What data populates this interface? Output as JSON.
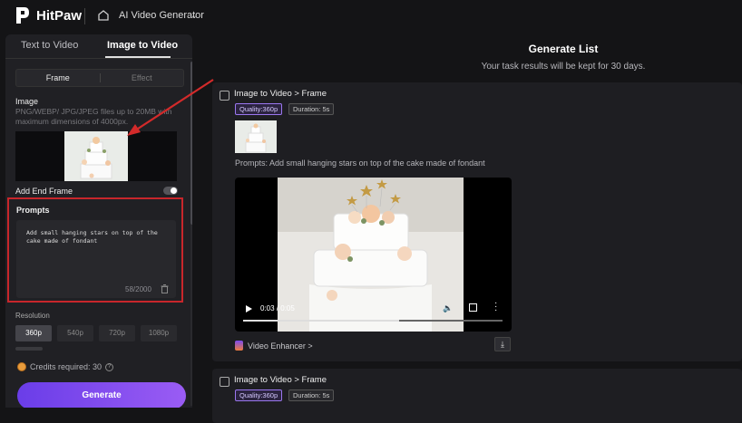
{
  "app": {
    "brand": "HitPaw",
    "tool_name": "AI Video Generator"
  },
  "tabs": [
    {
      "label": "Text to Video",
      "active": false
    },
    {
      "label": "Image to Video",
      "active": true
    }
  ],
  "mode_segment": {
    "options": [
      "Frame",
      "Effect"
    ],
    "selected": "Frame"
  },
  "image": {
    "label": "Image",
    "hint": "PNG/WEBP/ JPG/JPEG files up to 20MB with maximum dimensions of 4000px."
  },
  "end_frame": {
    "label": "Add End Frame",
    "enabled": false
  },
  "prompts": {
    "label": "Prompts",
    "value": "Add small hanging stars on top of the cake made of fondant",
    "count": "58/2000"
  },
  "resolution": {
    "label": "Resolution",
    "options": [
      "360p",
      "540p",
      "720p",
      "1080p"
    ],
    "selected": "360p"
  },
  "credits": {
    "label": "Credits required: 30"
  },
  "generate_button": "Generate",
  "generate_list": {
    "title": "Generate List",
    "subtitle": "Your task results will be kept for 30 days."
  },
  "tasks": [
    {
      "title": "Image to Video > Frame",
      "quality": "Quality:360p",
      "duration": "Duration: 5s",
      "prompt": "Prompts:  Add small hanging stars on top of the cake made of fondant",
      "player": {
        "time": "0:03 / 0:05",
        "progress": 0.6
      },
      "enhancer": "Video Enhancer >"
    },
    {
      "title": "Image to Video > Frame",
      "quality": "Quality:360p",
      "duration": "Duration: 5s"
    }
  ],
  "colors": {
    "accent": "#8a4ff0",
    "highlight_box": "#c8262b",
    "background": "#141416"
  }
}
